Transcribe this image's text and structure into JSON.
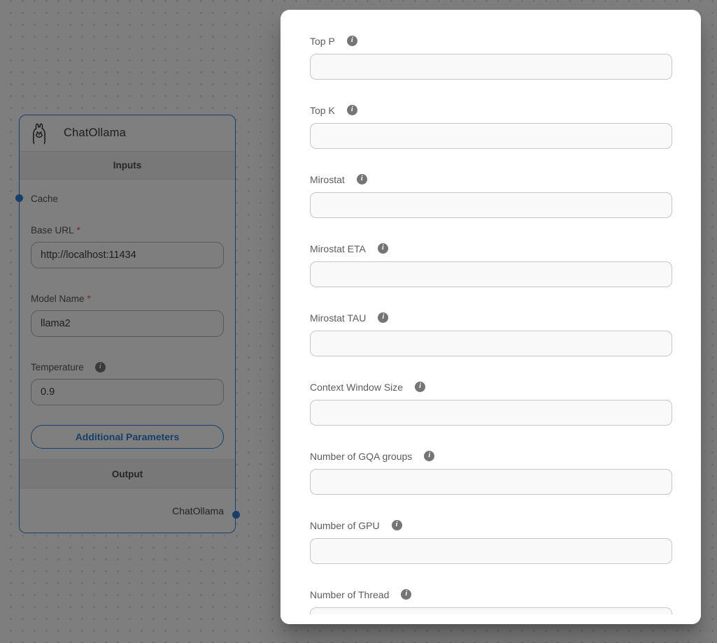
{
  "node": {
    "title": "ChatOllama",
    "sections": {
      "inputs": "Inputs",
      "output": "Output"
    },
    "cache": {
      "label": "Cache"
    },
    "fields": [
      {
        "label": "Base URL",
        "required": "*",
        "value": "http://localhost:11434"
      },
      {
        "label": "Model Name",
        "required": "*",
        "value": "llama2"
      },
      {
        "label": "Temperature",
        "value": "0.9"
      }
    ],
    "button": {
      "label": "Additional Parameters"
    },
    "output": {
      "label": "ChatOllama"
    }
  },
  "modal": {
    "fields": [
      {
        "label": "Top P",
        "value": ""
      },
      {
        "label": "Top K",
        "value": ""
      },
      {
        "label": "Mirostat",
        "value": ""
      },
      {
        "label": "Mirostat ETA",
        "value": ""
      },
      {
        "label": "Mirostat TAU",
        "value": ""
      },
      {
        "label": "Context Window Size",
        "value": ""
      },
      {
        "label": "Number of GQA groups",
        "value": ""
      },
      {
        "label": "Number of GPU",
        "value": ""
      },
      {
        "label": "Number of Thread",
        "value": ""
      }
    ]
  },
  "icons": {
    "info_glyph": "i",
    "node_icon": "ollama-llama-icon"
  },
  "colors": {
    "accent": "#2e7fd4",
    "required": "#e8564a",
    "backdrop": "rgba(0,0,0,0.5)"
  }
}
